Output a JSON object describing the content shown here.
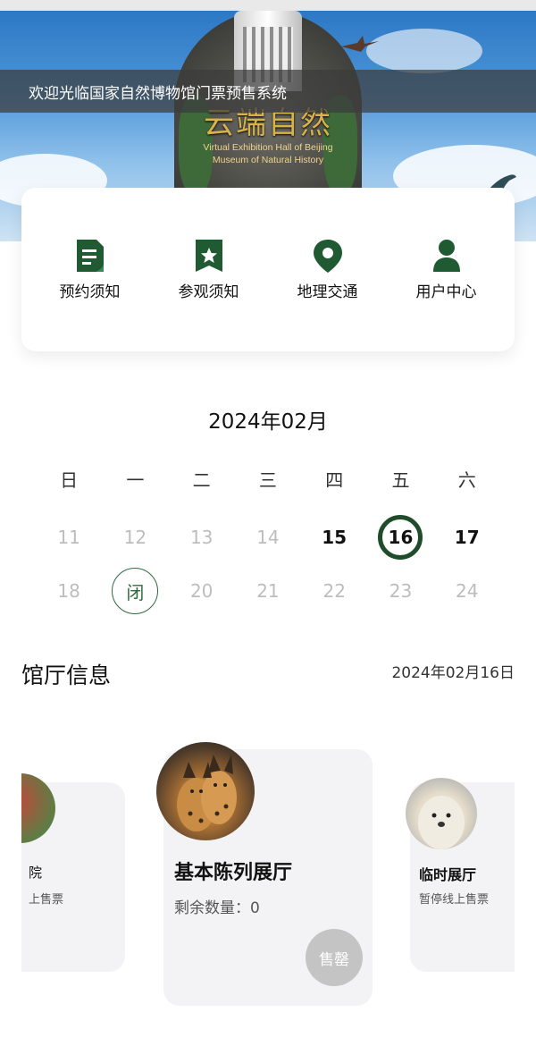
{
  "banner": {
    "marquee": "欢迎光临国家自然博物馆门票预售系统",
    "logo_title": "云端自然",
    "logo_subtitle_1": "Virtual Exhibition Hall of Beijing",
    "logo_subtitle_2": "Museum of Natural History"
  },
  "quick_menu": [
    {
      "label": "预约须知",
      "icon": "document-icon"
    },
    {
      "label": "参观须知",
      "icon": "bookmark-star-icon"
    },
    {
      "label": "地理交通",
      "icon": "location-pin-icon"
    },
    {
      "label": "用户中心",
      "icon": "user-icon"
    }
  ],
  "calendar": {
    "title": "2024年02月",
    "weekdays": [
      "日",
      "一",
      "二",
      "三",
      "四",
      "五",
      "六"
    ],
    "week1": [
      "11",
      "12",
      "13",
      "14",
      "15",
      "16",
      "17"
    ],
    "week2": [
      "18",
      "闭",
      "20",
      "21",
      "22",
      "23",
      "24"
    ],
    "selected": "16",
    "closed_label": "闭"
  },
  "halls_section": {
    "title": "馆厅信息",
    "date": "2024年02月16日"
  },
  "halls": {
    "left": {
      "name": "院",
      "sub": "上售票"
    },
    "center": {
      "name": "基本陈列展厅",
      "remaining": "剩余数量：0",
      "button": "售罄"
    },
    "right": {
      "name": "临时展厅",
      "sub": "暂停线上售票"
    }
  },
  "colors": {
    "brand_green": "#1f4d2b",
    "disabled_grey": "#c4c4c4"
  }
}
